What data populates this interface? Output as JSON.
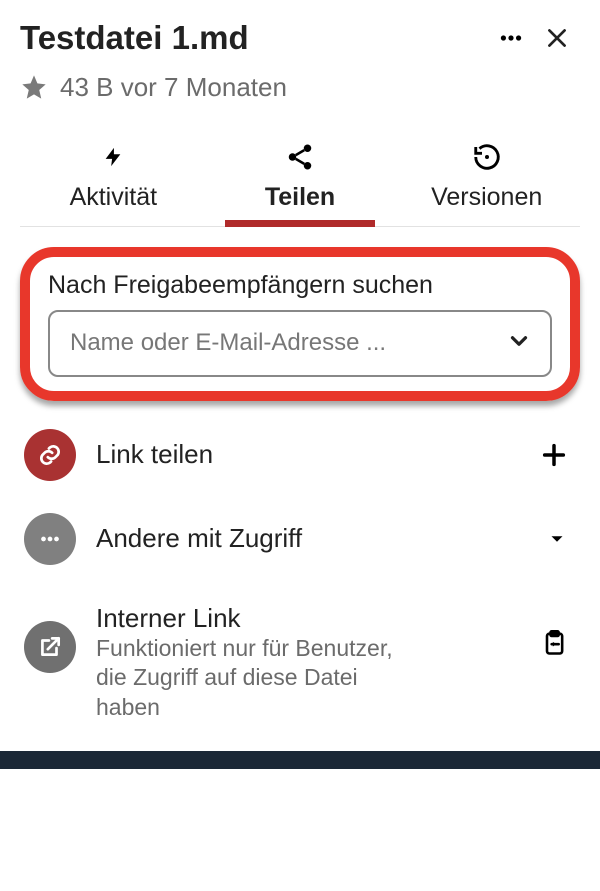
{
  "header": {
    "title": "Testdatei 1.md"
  },
  "meta": {
    "text": "43 B vor 7 Monaten"
  },
  "tabs": {
    "activity": "Aktivität",
    "share": "Teilen",
    "versions": "Versionen"
  },
  "search": {
    "label": "Nach Freigabeempfängern suchen",
    "placeholder": "Name oder E-Mail-Adresse ..."
  },
  "share_link": {
    "label": "Link teilen"
  },
  "others": {
    "label": "Andere mit Zugriff"
  },
  "internal_link": {
    "title": "Interner Link",
    "desc": "Funktioniert nur für Benutzer, die Zugriff auf diese Datei haben"
  }
}
